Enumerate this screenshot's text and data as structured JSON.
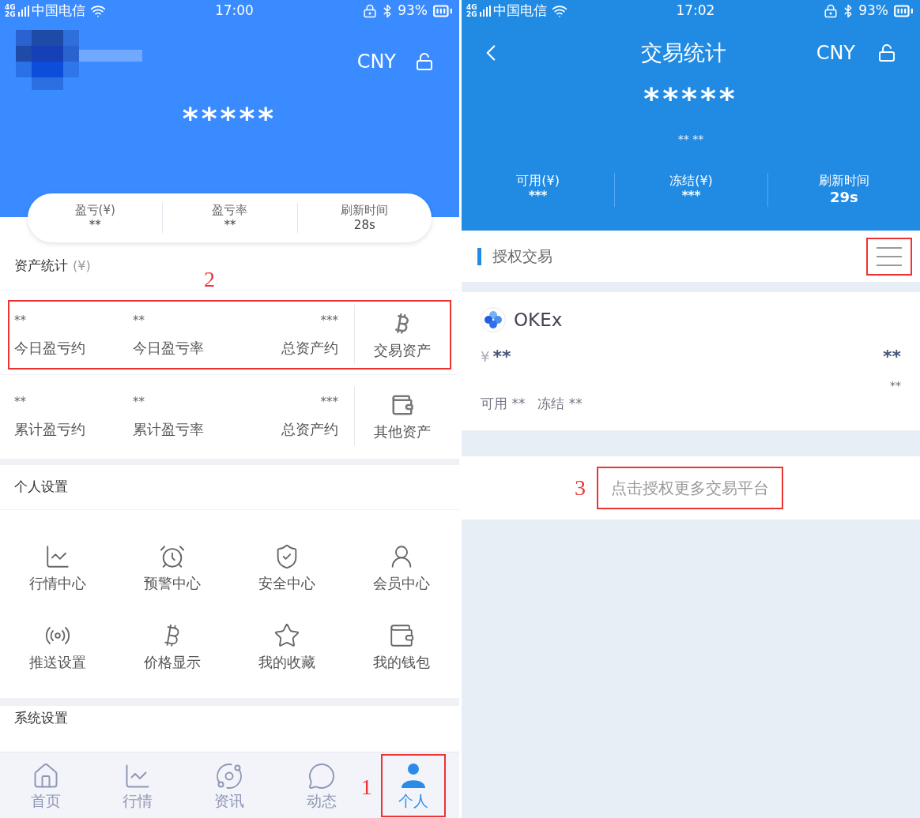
{
  "left": {
    "status": {
      "network": [
        "4G",
        "2G"
      ],
      "carrier": "中国电信",
      "time": "17:00",
      "battery": "93%"
    },
    "currency": "CNY",
    "balance": "*****",
    "summary": [
      {
        "label": "盈亏(¥)",
        "value": "**"
      },
      {
        "label": "盈亏率",
        "value": "**"
      },
      {
        "label": "刷新时间",
        "value": "28s"
      }
    ],
    "asset_section": {
      "title": "资产统计",
      "unit": "(¥)"
    },
    "asset_rows": [
      {
        "highlighted": true,
        "annotation": "2",
        "cells": [
          {
            "value": "**",
            "label": "今日盈亏约"
          },
          {
            "value": "**",
            "label": "今日盈亏率"
          },
          {
            "value": "***",
            "label": "总资产约"
          }
        ],
        "link": "交易资产"
      },
      {
        "highlighted": false,
        "cells": [
          {
            "value": "**",
            "label": "累计盈亏约"
          },
          {
            "value": "**",
            "label": "累计盈亏率"
          },
          {
            "value": "***",
            "label": "总资产约"
          }
        ],
        "link": "其他资产"
      }
    ],
    "personal_section": "个人设置",
    "shortcuts": [
      "行情中心",
      "预警中心",
      "安全中心",
      "会员中心",
      "推送设置",
      "价格显示",
      "我的收藏",
      "我的钱包"
    ],
    "system_section": "系统设置",
    "tabs": [
      {
        "label": "首页",
        "selected": false,
        "highlighted": false
      },
      {
        "label": "行情",
        "selected": false,
        "highlighted": false
      },
      {
        "label": "资讯",
        "selected": false,
        "highlighted": false
      },
      {
        "label": "动态",
        "selected": false,
        "highlighted": false
      },
      {
        "label": "个人",
        "selected": true,
        "highlighted": true,
        "annotation": "1"
      }
    ]
  },
  "right": {
    "status": {
      "network": [
        "4G",
        "2G"
      ],
      "carrier": "中国电信",
      "time": "17:02",
      "battery": "93%"
    },
    "title": "交易统计",
    "currency": "CNY",
    "balance": "*****",
    "sub_balance": "** **",
    "summary": [
      {
        "label": "可用(¥)",
        "value": "***"
      },
      {
        "label": "冻结(¥)",
        "value": "***"
      },
      {
        "label": "刷新时间",
        "value": "29s"
      }
    ],
    "section": {
      "title": "授权交易",
      "menu_highlighted": true
    },
    "exchange": {
      "name": "OKEx",
      "currency_sign": "¥",
      "amount": "**",
      "amount_right": "**",
      "small_right": "**",
      "available_label": "可用",
      "available": "**",
      "frozen_label": "冻结",
      "frozen": "**"
    },
    "authorize": {
      "label": "点击授权更多交易平台",
      "highlighted": true,
      "annotation": "3"
    }
  }
}
